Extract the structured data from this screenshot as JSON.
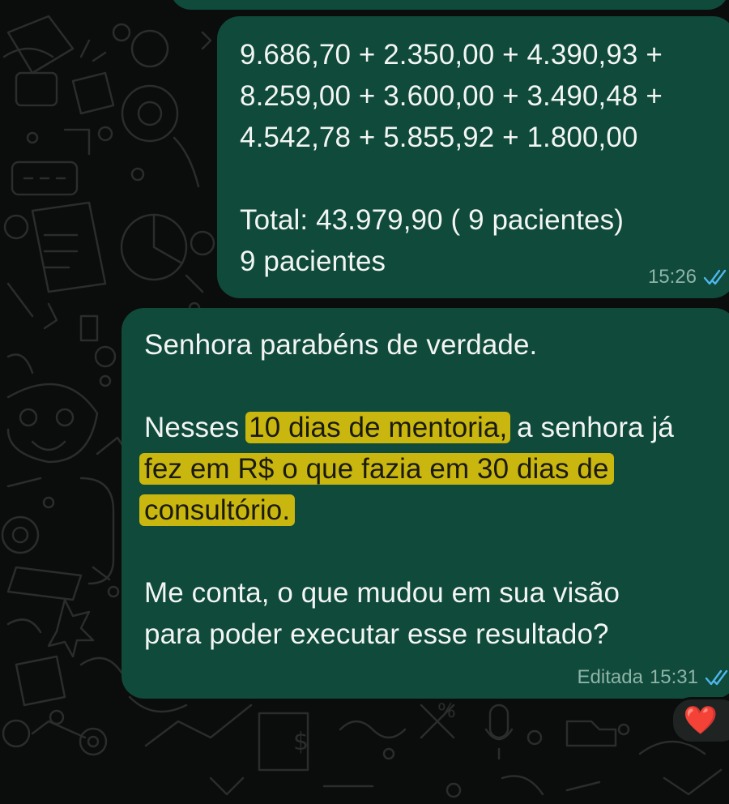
{
  "theme": {
    "background": "#0b0c0c",
    "bubble_color": "#0f4a3a",
    "highlight_color": "#c9b70f",
    "read_tick_color": "#4fb6ec",
    "meta_color": "#8fb4a7",
    "reaction_bg": "#1f2422"
  },
  "messages": [
    {
      "lines": [
        "9.686,70 + 2.350,00 + 4.390,93 +",
        "8.259,00 + 3.600,00 + 3.490,48 +",
        "4.542,78 + 5.855,92 + 1.800,00",
        "",
        "Total: 43.979,90 ( 9 pacientes)",
        "9 pacientes"
      ],
      "time": "15:26",
      "status_icon": "double-check-read-icon"
    },
    {
      "line1": "Senhora parabéns de verdade.",
      "line2_prefix": "Nesses ",
      "line2_highlight": "10 dias de mentoria,",
      "line2_suffix": " a senhora já",
      "line3_highlight": "fez em R$ o que fazia em 30 dias de",
      "line4_highlight": "consultório.",
      "line5": "Me conta, o que mudou em sua visão",
      "line6": "para poder executar esse resultado?",
      "edited_label": "Editada",
      "time": "15:31",
      "status_icon": "double-check-read-icon",
      "reaction": "❤️"
    }
  ]
}
